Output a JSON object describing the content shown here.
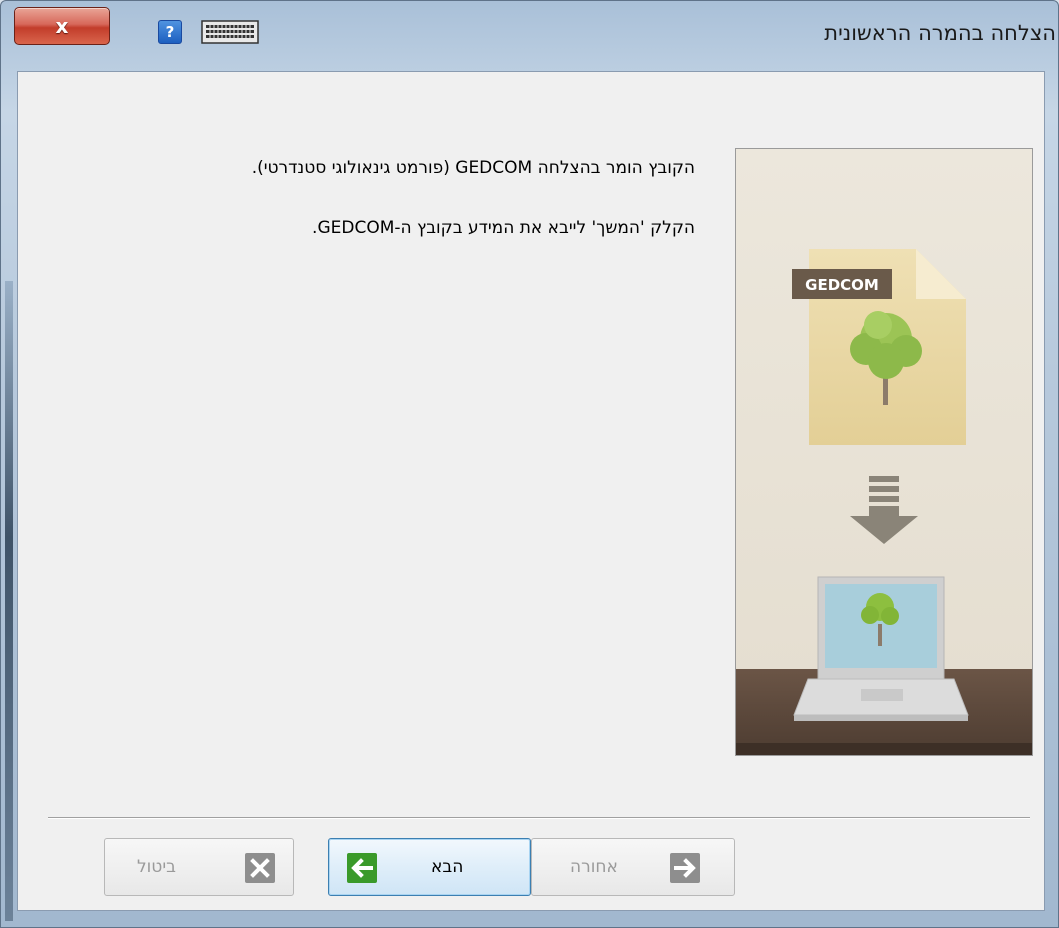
{
  "window": {
    "title": "הצלחה בהמרה הראשונית",
    "close_label": "x"
  },
  "content": {
    "line1": "הקובץ הומר בהצלחה GEDCOM (פורמט גינאולוגי סטנדרטי).",
    "line2": "הקלק 'המשך' לייבא את המידע בקובץ ה-GEDCOM."
  },
  "illustration": {
    "file_badge": "GEDCOM"
  },
  "buttons": {
    "cancel_label": "ביטול",
    "next_label": "הבא",
    "back_label": "אחורה"
  },
  "colors": {
    "next_arrow": "#3a9a2a",
    "close_button": "#c9463a"
  }
}
